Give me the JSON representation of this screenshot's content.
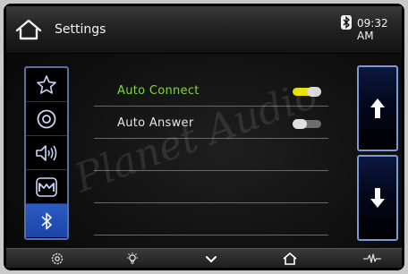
{
  "header": {
    "title": "Settings",
    "time": "09:32 AM",
    "home_icon": "home-icon",
    "status_icon": "bluetooth-icon"
  },
  "left_rail": {
    "items": [
      {
        "icon": "star-icon",
        "active": false
      },
      {
        "icon": "disc-icon",
        "active": false
      },
      {
        "icon": "speaker-icon",
        "active": false
      },
      {
        "icon": "mountain-logo-icon",
        "active": false
      },
      {
        "icon": "bluetooth-icon",
        "active": true
      }
    ]
  },
  "list": {
    "rows": [
      {
        "label": "Auto Connect",
        "toggle_on": true,
        "label_color": "#7fd83a"
      },
      {
        "label": "Auto Answer",
        "toggle_on": false,
        "label_color": "#e6e6e6"
      }
    ]
  },
  "scroll": {
    "up_icon": "arrow-up-icon",
    "down_icon": "arrow-down-icon"
  },
  "bottom_bar": {
    "items": [
      "settings-gear-icon",
      "brightness-icon",
      "chevron-down-icon",
      "home-icon",
      "waveform-icon"
    ]
  },
  "watermark": "Planet Audio",
  "colors": {
    "accent_blue": "#2b5cc4",
    "toggle_on": "#e8e000",
    "toggle_off": "#9a9a9a",
    "active_label": "#7fd83a"
  }
}
